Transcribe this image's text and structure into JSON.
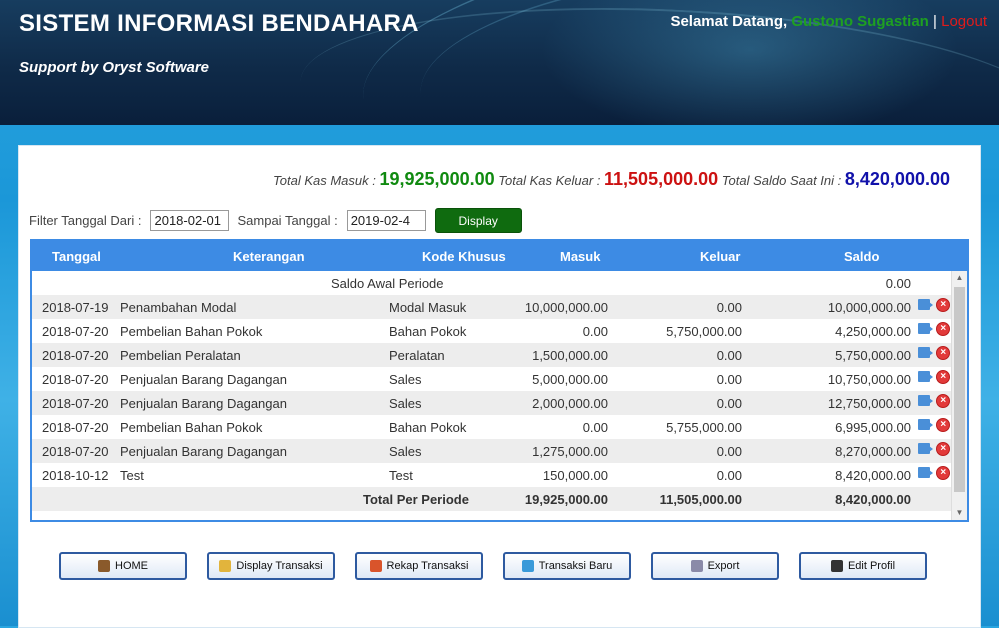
{
  "app": {
    "title": "SISTEM INFORMASI BENDAHARA",
    "subtitle": "Support by Oryst Software",
    "welcome_label": "Selamat Datang,",
    "user_name": "Gustono Sugastian",
    "separator": "|",
    "logout_label": "Logout"
  },
  "totals": {
    "kas_masuk_label": "Total Kas Masuk :",
    "kas_masuk": "19,925,000.00",
    "kas_keluar_label": "Total Kas Keluar :",
    "kas_keluar": "11,505,000.00",
    "saldo_label": "Total Saldo Saat Ini :",
    "saldo": "8,420,000.00"
  },
  "filter": {
    "dari_label": "Filter Tanggal Dari :",
    "dari_value": "2018-02-01",
    "sampai_label": "Sampai Tanggal :",
    "sampai_value": "2019-02-4",
    "display_label": "Display"
  },
  "table": {
    "headers": [
      "Tanggal",
      "Keterangan",
      "Kode Khusus",
      "Masuk",
      "Keluar",
      "Saldo"
    ],
    "opening": {
      "label": "Saldo Awal Periode",
      "saldo": "0.00"
    },
    "rows": [
      [
        "2018-07-19",
        "Penambahan Modal",
        "Modal Masuk",
        "10,000,000.00",
        "0.00",
        "10,000,000.00"
      ],
      [
        "2018-07-20",
        "Pembelian Bahan Pokok",
        "Bahan Pokok",
        "0.00",
        "5,750,000.00",
        "4,250,000.00"
      ],
      [
        "2018-07-20",
        "Pembelian Peralatan",
        "Peralatan",
        "1,500,000.00",
        "0.00",
        "5,750,000.00"
      ],
      [
        "2018-07-20",
        "Penjualan Barang Dagangan",
        "Sales",
        "5,000,000.00",
        "0.00",
        "10,750,000.00"
      ],
      [
        "2018-07-20",
        "Penjualan Barang Dagangan",
        "Sales",
        "2,000,000.00",
        "0.00",
        "12,750,000.00"
      ],
      [
        "2018-07-20",
        "Pembelian Bahan Pokok",
        "Bahan Pokok",
        "0.00",
        "5,755,000.00",
        "6,995,000.00"
      ],
      [
        "2018-07-20",
        "Penjualan Barang Dagangan",
        "Sales",
        "1,275,000.00",
        "0.00",
        "8,270,000.00"
      ],
      [
        "2018-10-12",
        "Test",
        "Test",
        "150,000.00",
        "0.00",
        "8,420,000.00"
      ]
    ],
    "total": {
      "label": "Total Per Periode",
      "masuk": "19,925,000.00",
      "keluar": "11,505,000.00",
      "saldo": "8,420,000.00"
    }
  },
  "nav": [
    {
      "label": "HOME",
      "icon": "home-icon",
      "color": "#8a5a2b"
    },
    {
      "label": "Display Transaksi",
      "icon": "document-icon",
      "color": "#e2b43c"
    },
    {
      "label": "Rekap Transaksi",
      "icon": "chart-icon",
      "color": "#d9542b"
    },
    {
      "label": "Transaksi Baru",
      "icon": "new-transaction-icon",
      "color": "#3a9ad9"
    },
    {
      "label": "Export",
      "icon": "export-icon",
      "color": "#8a8aa8"
    },
    {
      "label": "Edit Profil",
      "icon": "user-icon",
      "color": "#333333"
    }
  ]
}
